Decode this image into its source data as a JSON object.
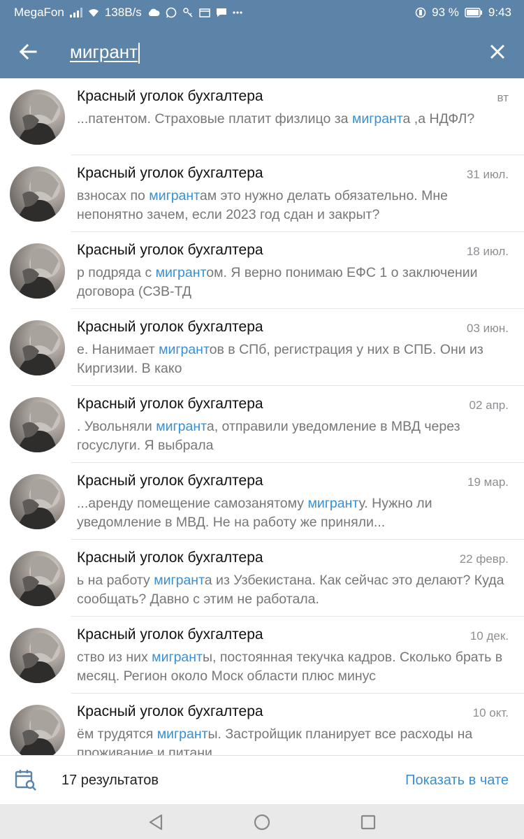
{
  "status_bar": {
    "carrier": "MegaFon",
    "speed": "138B/s",
    "battery": "93 %",
    "time": "9:43",
    "icons_left": [
      "signal-icon",
      "wifi-icon",
      "cloud-icon",
      "whatsapp-icon",
      "vpn-icon",
      "calendar-icon",
      "message-icon",
      "more-icon"
    ],
    "icons_right": [
      "vibrate-icon",
      "battery-icon"
    ]
  },
  "header": {
    "search_value": "мигрант",
    "back_icon": "back-arrow-icon",
    "clear_icon": "close-icon"
  },
  "colors": {
    "header_bg": "#5b84a8",
    "highlight": "#3a8fd0",
    "snippet_text": "#777777"
  },
  "results": [
    {
      "title": "Красный уголок бухгалтера",
      "date": "вт",
      "snippet_before": "...патентом. Страховые платит физлицо за ",
      "snippet_match": "мигрант",
      "snippet_after": "а ,а НДФЛ?"
    },
    {
      "title": "Красный уголок бухгалтера",
      "date": "31 июл.",
      "snippet_before": " взносах по ",
      "snippet_match": "мигрант",
      "snippet_after": "ам это нужно делать обязательно. Мне непонятно зачем, если 2023 год сдан и закрыт?"
    },
    {
      "title": "Красный уголок бухгалтера",
      "date": "18 июл.",
      "snippet_before": "р подряда с ",
      "snippet_match": "мигрант",
      "snippet_after": "ом. Я верно понимаю  ЕФС 1 о заключении договора  (СЗВ-ТД"
    },
    {
      "title": "Красный уголок бухгалтера",
      "date": "03 июн.",
      "snippet_before": "е. Нанимает ",
      "snippet_match": "мигрант",
      "snippet_after": "ов в СПб, регистрация у них в СПБ. Они из Киргизии. В како"
    },
    {
      "title": "Красный уголок бухгалтера",
      "date": "02 апр.",
      "snippet_before": ". Увольняли ",
      "snippet_match": "мигрант",
      "snippet_after": "а, отправили уведомление в МВД через госуслуги. Я выбрала"
    },
    {
      "title": "Красный уголок бухгалтера",
      "date": "19 мар.",
      "snippet_before": "...аренду помещение самозанятому ",
      "snippet_match": "мигрант",
      "snippet_after": "у. Нужно ли уведомление в МВД. Не на работу же приняли..."
    },
    {
      "title": "Красный уголок бухгалтера",
      "date": "22 февр.",
      "snippet_before": "ь на работу ",
      "snippet_match": "мигрант",
      "snippet_after": "а из Узбекистана. Как сейчас это делают? Куда сообщать? Давно с этим не работала."
    },
    {
      "title": "Красный уголок бухгалтера",
      "date": "10 дек.",
      "snippet_before": "ство из них ",
      "snippet_match": "мигрант",
      "snippet_after": "ы, постоянная текучка кадров. Сколько брать в месяц. Регион около Моск области плюс минус"
    },
    {
      "title": "Красный уголок бухгалтера",
      "date": "10 окт.",
      "snippet_before": "ём трудятся ",
      "snippet_match": "мигрант",
      "snippet_after": "ы. Застройщик планирует все расходы на проживание и питани"
    }
  ],
  "bottom_bar": {
    "results_count": "17 результатов",
    "show_in_chat": "Показать в чате",
    "calendar_icon": "calendar-search-icon"
  },
  "nav_bar": {
    "icons": [
      "nav-back-icon",
      "nav-home-icon",
      "nav-recents-icon"
    ]
  }
}
